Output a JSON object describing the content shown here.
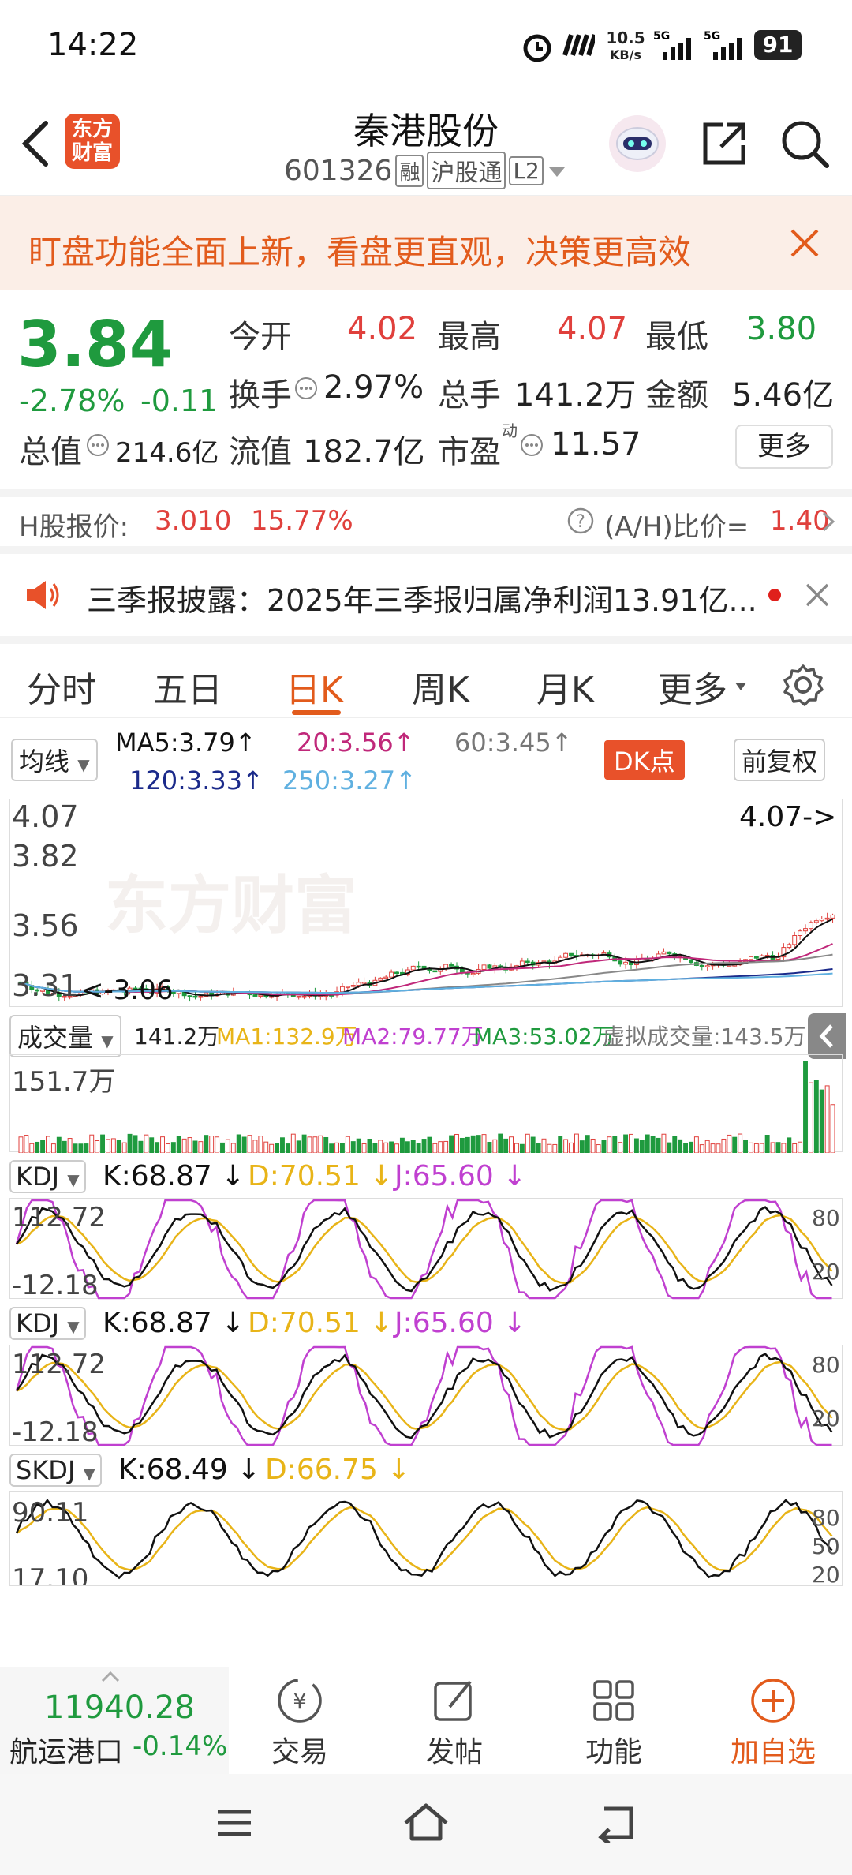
{
  "status": {
    "time": "14:22",
    "net_speed_value": "10.5",
    "net_speed_unit": "KB/s",
    "battery": "91"
  },
  "header": {
    "logo_line1": "东方",
    "logo_line2": "财富",
    "stock_name": "秦港股份",
    "stock_code": "601326",
    "tag_rong": "融",
    "tag_hgt": "沪股通",
    "tag_l2": "L2"
  },
  "banner": {
    "text": "盯盘功能全面上新，看盘更直观，决策更高效"
  },
  "quote": {
    "price": "3.84",
    "change_pct": "-2.78%",
    "change_amt": "-0.11",
    "open_label": "今开",
    "open": "4.02",
    "high_label": "最高",
    "high": "4.07",
    "low_label": "最低",
    "low": "3.80",
    "turnover_label": "换手",
    "turnover": "2.97%",
    "volume_label": "总手",
    "volume": "141.2万",
    "amount_label": "金额",
    "amount": "5.46亿",
    "total_cap_label": "总值",
    "total_cap": "214.6亿",
    "float_cap_label": "流值",
    "float_cap": "182.7亿",
    "pe_label": "市盈",
    "pe_sup": "动",
    "pe": "11.57",
    "more_label": "更多"
  },
  "hshare": {
    "label": "H股报价:",
    "price": "3.010",
    "pct": "15.77%",
    "ah_label": "(A/H)比价=",
    "ah_value": "1.40"
  },
  "news": {
    "text": "三季报披露：2025年三季报归属净利润13.91亿..."
  },
  "tabs": [
    "分时",
    "五日",
    "日K",
    "周K",
    "月K",
    "更多"
  ],
  "active_tab": "日K",
  "ma_bar": {
    "selector": "均线",
    "ma5": "MA5:3.79",
    "ma20": "20:3.56",
    "ma60": "60:3.45",
    "ma120": "120:3.33",
    "ma250": "250:3.27",
    "dk_label": "DK点",
    "fq_label": "前复权"
  },
  "kline": {
    "y_labels": [
      "4.07",
      "3.82",
      "3.56",
      "3.31",
      "3.06"
    ],
    "high_marker": "4.07->",
    "low_marker": "<-3.06",
    "watermark": "东方财富"
  },
  "volume_bar": {
    "selector": "成交量",
    "vol": "141.2万",
    "ma1": "MA1:132.9万",
    "ma2": "MA2:79.77万",
    "ma3": "MA3:53.02万",
    "virtual": "虚拟成交量:143.5万",
    "y_label": "151.7万"
  },
  "kdj1": {
    "selector": "KDJ",
    "k": "K:68.87",
    "d": "D:70.51",
    "j": "J:65.60",
    "y_top": "112.72",
    "y_bottom": "-12.18",
    "right_top": "80",
    "right_bottom": "20"
  },
  "kdj2": {
    "selector": "KDJ",
    "k": "K:68.87",
    "d": "D:70.51",
    "j": "J:65.60",
    "y_top": "112.72",
    "y_bottom": "-12.18",
    "right_top": "80",
    "right_bottom": "20"
  },
  "skdj": {
    "selector": "SKDJ",
    "k": "K:68.49",
    "d": "D:66.75",
    "y_top": "90.11",
    "y_bottom": "17.10",
    "right_top": "80",
    "right_mid": "50",
    "right_bottom": "20"
  },
  "bottom": {
    "index_value": "11940.28",
    "index_name": "航运港口",
    "index_pct": "-0.14%",
    "trade": "交易",
    "post": "发帖",
    "func": "功能",
    "add": "加自选"
  },
  "colors": {
    "accent": "#e25b1c",
    "up": "#e0403c",
    "down": "#1f9a3e",
    "ma5": "#111111",
    "ma20": "#c0287a",
    "ma60": "#888888",
    "ma120": "#1b2a8a",
    "ma250": "#5fb0e0",
    "kdj_k": "#111111",
    "kdj_d": "#e8b418",
    "kdj_j": "#c040d0"
  }
}
